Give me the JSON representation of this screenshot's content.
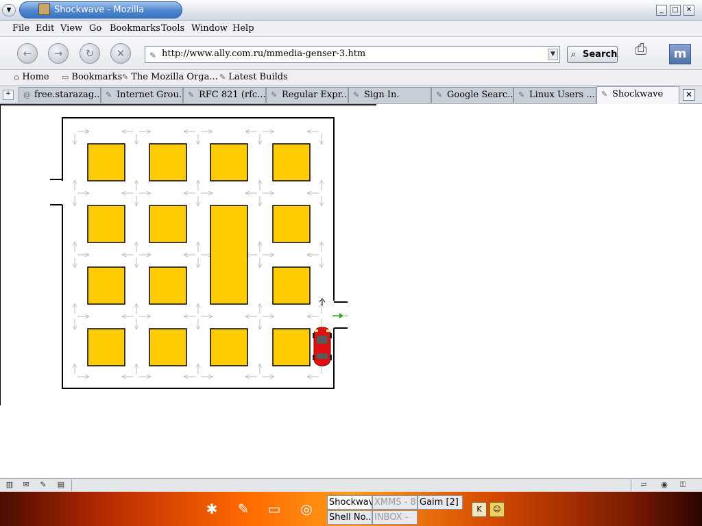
{
  "window": {
    "title": "Shockwave - Mozilla",
    "controls": {
      "minimize": "_",
      "maximize": "□",
      "close": "✕"
    }
  },
  "menubar": {
    "items": [
      {
        "label": "File",
        "access": "F"
      },
      {
        "label": "Edit",
        "access": "E"
      },
      {
        "label": "View",
        "access": "V"
      },
      {
        "label": "Go",
        "access": "G"
      },
      {
        "label": "Bookmarks",
        "access": "B"
      },
      {
        "label": "Tools",
        "access": "T"
      },
      {
        "label": "Window",
        "access": "W"
      },
      {
        "label": "Help",
        "access": "H"
      }
    ]
  },
  "navbar": {
    "back_icon": "back-arrow-icon",
    "forward_icon": "forward-arrow-icon",
    "reload_icon": "reload-icon",
    "stop_icon": "stop-icon",
    "url": "http://www.ally.com.ru/mmedia-genser-3.htm",
    "search_label": "Search",
    "throbber_label": "m"
  },
  "personal_toolbar": {
    "items": [
      "Home",
      "Bookmarks",
      "The Mozilla Orga...",
      "Latest Builds"
    ]
  },
  "tabs": [
    {
      "label": "free.starazag..."
    },
    {
      "label": "Internet Grou..."
    },
    {
      "label": "RFC 821 (rfc..."
    },
    {
      "label": "Regular Expr..."
    },
    {
      "label": "Sign In."
    },
    {
      "label": "Google Searc..."
    },
    {
      "label": "Linux Users ..."
    },
    {
      "label": "Shockwave",
      "active": true
    }
  ],
  "game": {
    "colors": {
      "block": "#ffcc00",
      "car": "#e01010",
      "arrow": "#bbbbbb",
      "exit_arrow": "#22aa22"
    }
  },
  "taskbar": {
    "tasks": [
      {
        "label": "Shockwave",
        "active": true
      },
      {
        "label": "XMMS - 8",
        "dim": true
      },
      {
        "label": "Gaim [2]"
      },
      {
        "label": "Shell No..."
      },
      {
        "label": "INBOX -",
        "dim": true
      }
    ],
    "tray_label": "K"
  }
}
